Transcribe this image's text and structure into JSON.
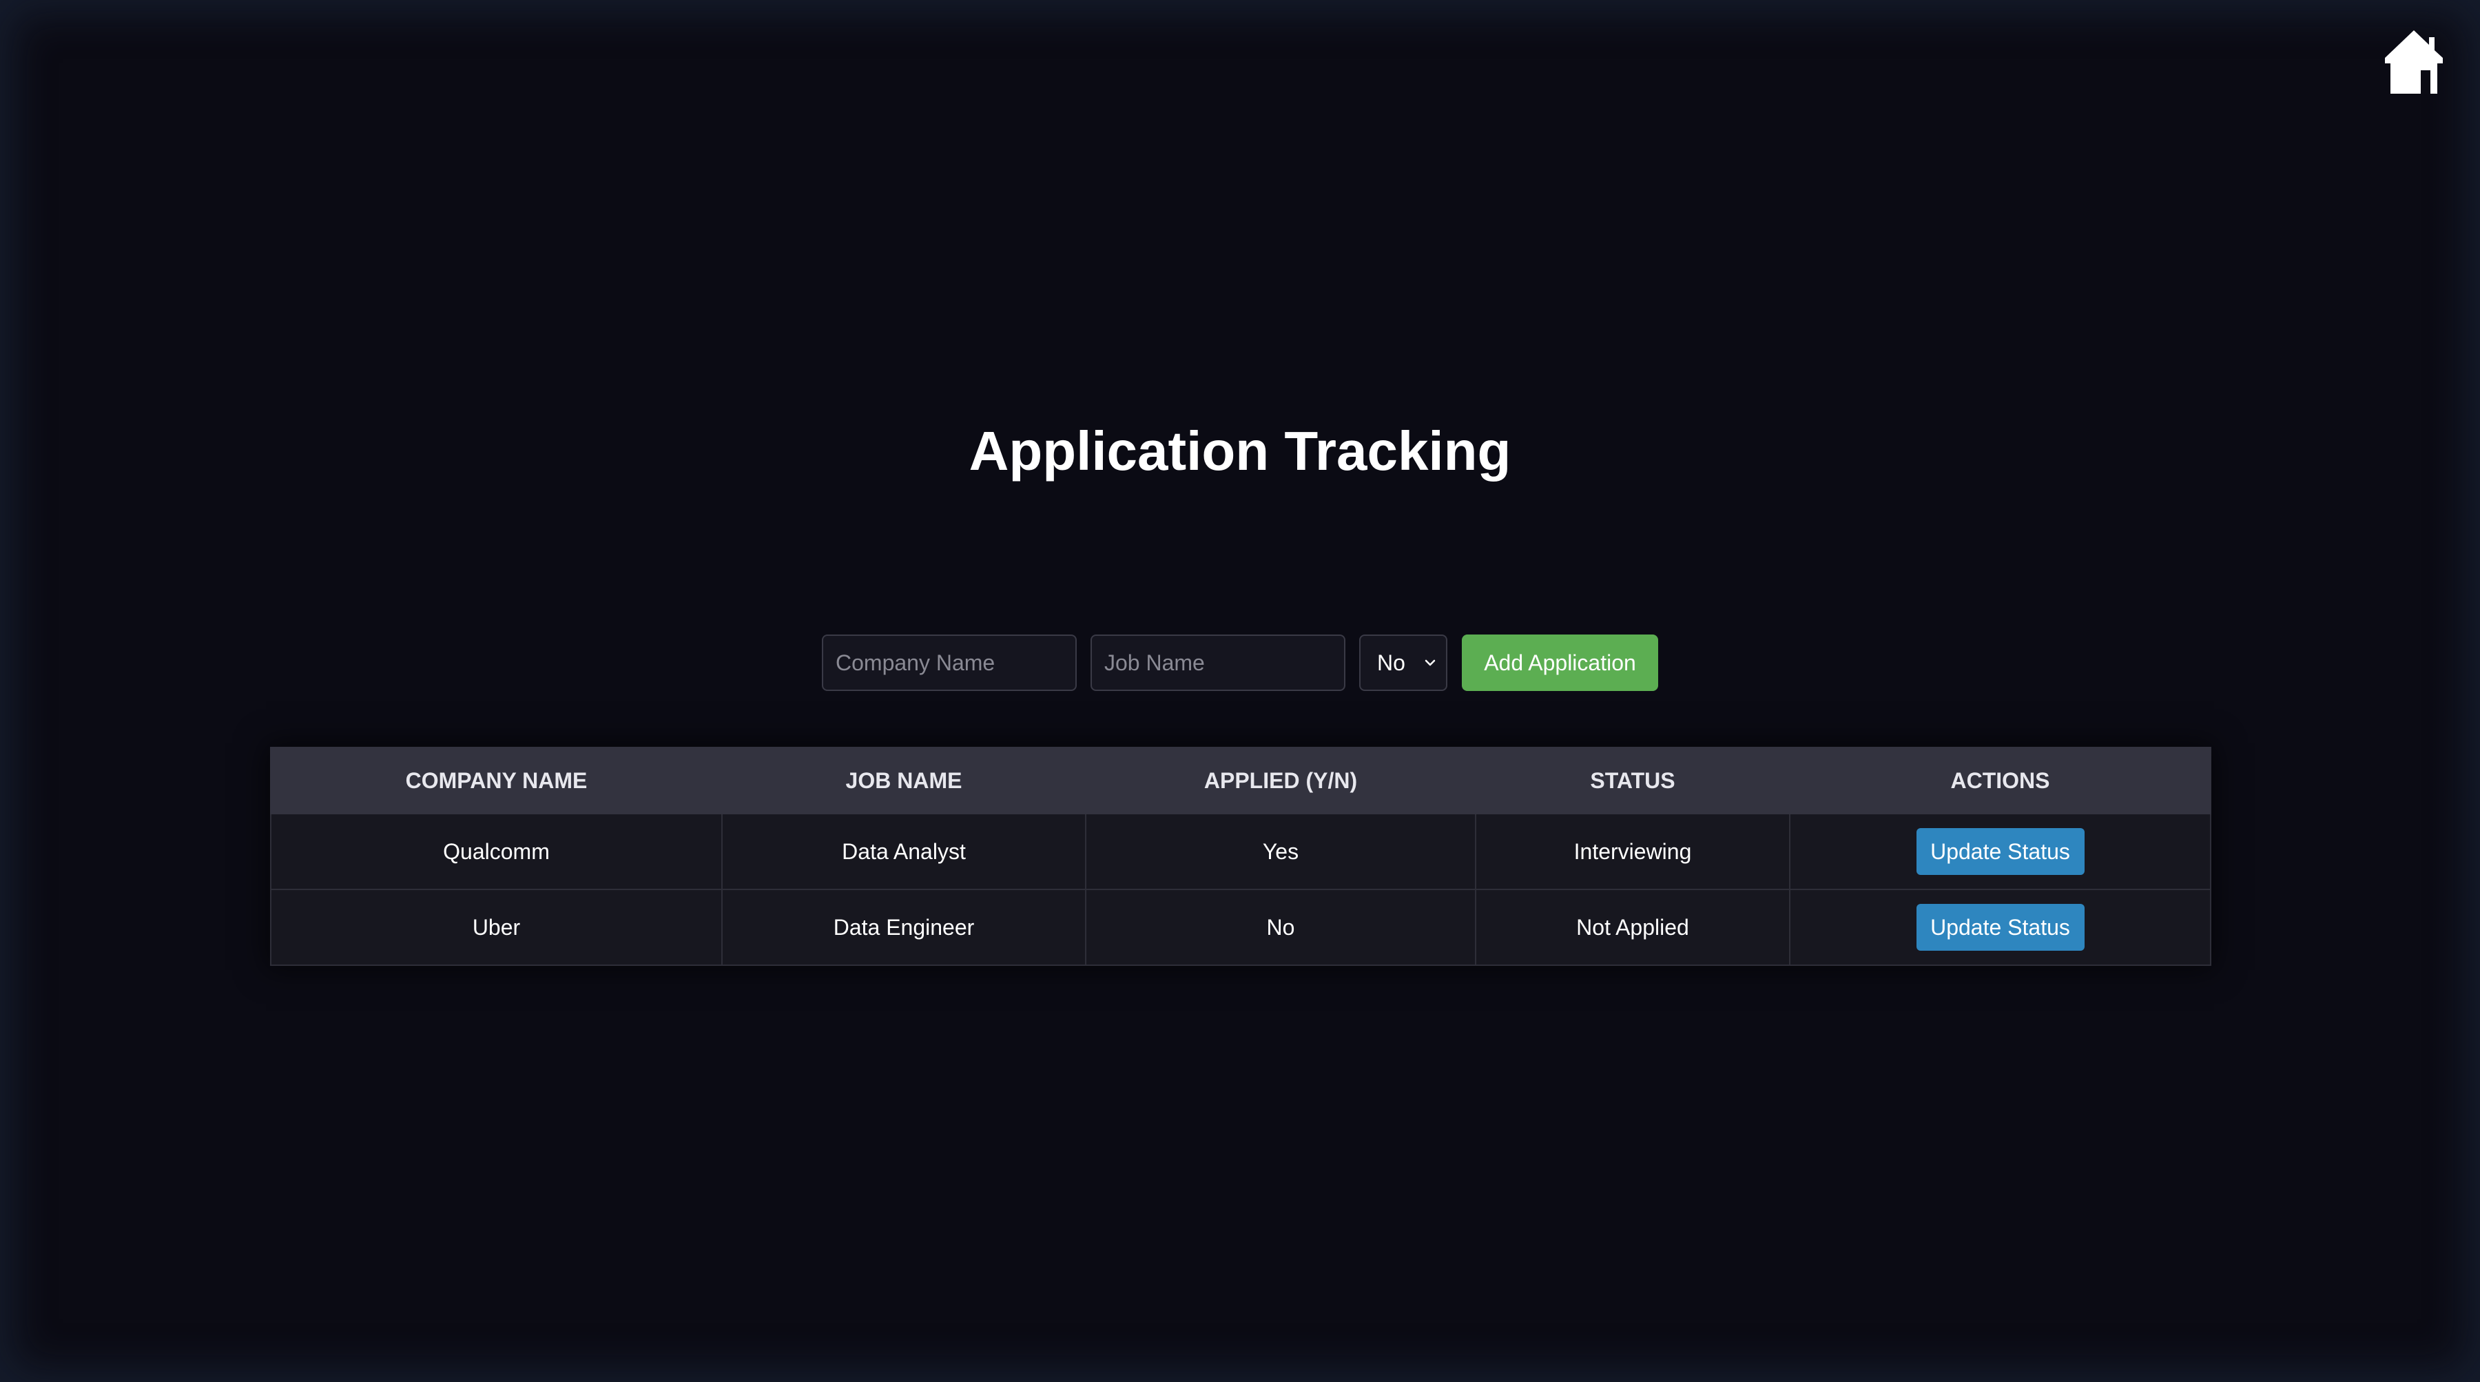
{
  "header": {
    "title": "Application Tracking",
    "home_icon": "home-icon"
  },
  "form": {
    "company_placeholder": "Company Name",
    "job_placeholder": "Job Name",
    "applied_select_value": "No",
    "add_button_label": "Add Application"
  },
  "table": {
    "columns": [
      "COMPANY NAME",
      "JOB NAME",
      "APPLIED (Y/N)",
      "STATUS",
      "ACTIONS"
    ],
    "rows": [
      {
        "company": "Qualcomm",
        "job": "Data Analyst",
        "applied": "Yes",
        "status": "Interviewing",
        "action": "Update Status"
      },
      {
        "company": "Uber",
        "job": "Data Engineer",
        "applied": "No",
        "status": "Not Applied",
        "action": "Update Status"
      }
    ]
  },
  "colors": {
    "background": "#0b0b14",
    "add_button": "#5cae52",
    "update_button": "#2e86bf",
    "table_header": "#33333f"
  }
}
